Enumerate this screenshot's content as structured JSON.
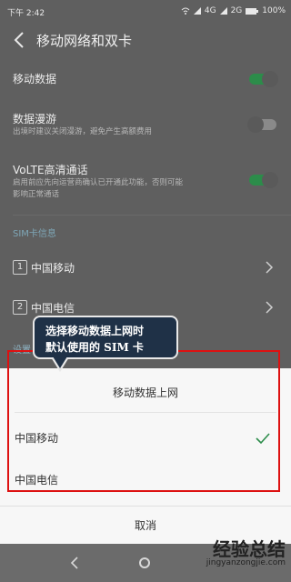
{
  "status": {
    "time": "下午 2:42",
    "network1": "4G",
    "network2": "2G",
    "battery": "100%"
  },
  "header": {
    "title": "移动网络和双卡"
  },
  "settings": {
    "mobile_data": {
      "label": "移动数据"
    },
    "roaming": {
      "label": "数据漫游",
      "desc": "出境时建议关闭漫游，避免产生高额费用"
    },
    "volte": {
      "label": "VoLTE高清通话",
      "desc_line1": "启用前应先向运营商确认已开通此功能，否则可能",
      "desc_line2": "影响正常通话"
    },
    "sim_section": "SIM卡信息",
    "sim1": {
      "num": "1",
      "label": "中国移动"
    },
    "sim2": {
      "num": "2",
      "label": "中国电信"
    },
    "partial": "设置"
  },
  "sheet": {
    "title": "移动数据上网",
    "options": [
      "中国移动",
      "中国电信"
    ],
    "selected_index": 0,
    "cancel": "取消"
  },
  "callout": {
    "line1": "选择移动数据上网时",
    "line2": "默认使用的 SIM 卡"
  },
  "watermark": {
    "main": "经验总结",
    "sub": "jingyanzongjie.com"
  },
  "colors": {
    "accent_green": "#2c8c4a",
    "highlight_red": "#dd1111",
    "callout_bg": "#1f3147"
  }
}
